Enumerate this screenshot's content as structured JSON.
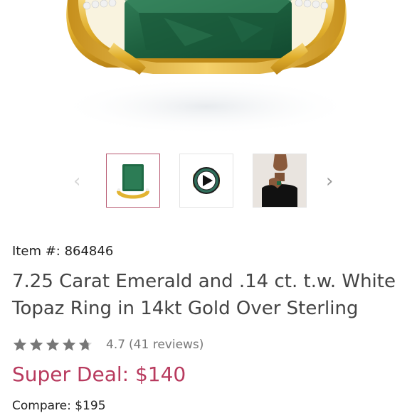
{
  "product": {
    "item_number_label": "Item #:",
    "item_number": "864846",
    "title": "7.25 Carat Emerald and .14 ct. t.w. White Topaz Ring in 14kt Gold Over Sterling",
    "rating": {
      "stars": 4.7,
      "value_text": "4.7",
      "reviews_text": "(41 reviews)"
    },
    "price_label": "Super Deal: $140",
    "compare_label": "Compare: $195"
  },
  "gallery": {
    "prev_icon": "chevron-left-icon",
    "next_icon": "chevron-right-icon",
    "thumbnails": [
      {
        "name": "ring-front-thumbnail",
        "selected": true
      },
      {
        "name": "video-play-thumbnail",
        "selected": false
      },
      {
        "name": "model-wearing-thumbnail",
        "selected": false
      }
    ]
  },
  "colors": {
    "accent": "#b83a5e",
    "selected_border": "#b85a72",
    "star": "#777777",
    "gold": "#e2b431",
    "emerald": "#1f6a45"
  }
}
